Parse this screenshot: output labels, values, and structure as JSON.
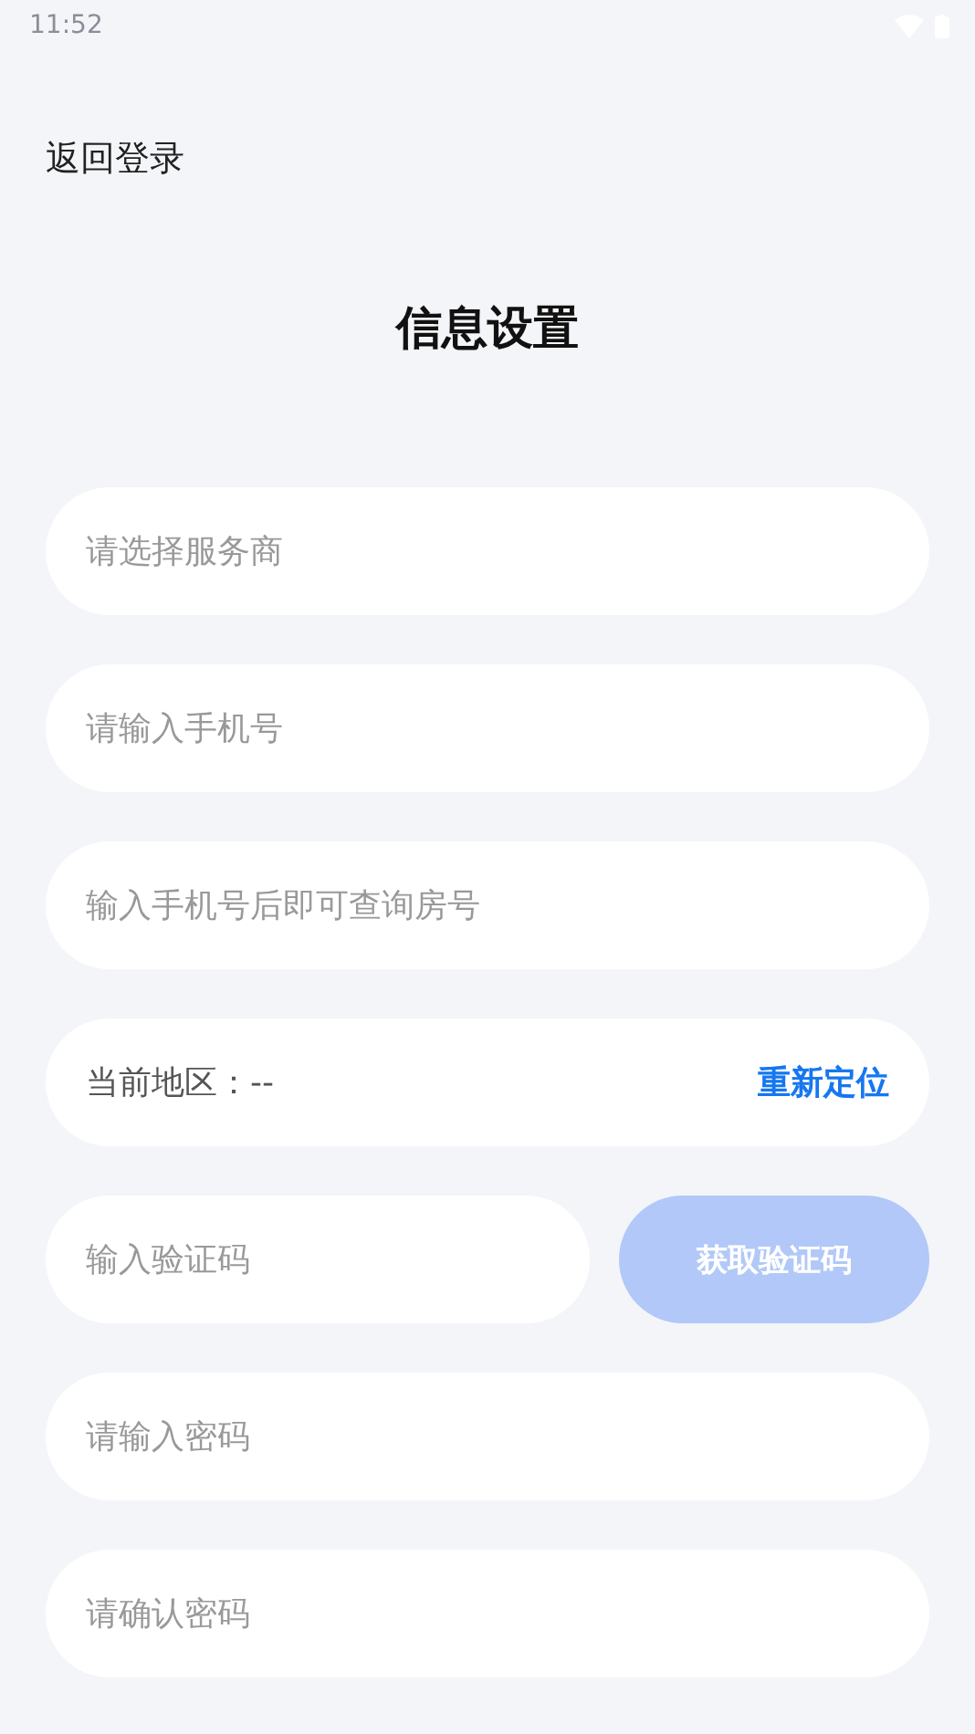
{
  "status_bar": {
    "time": "11:52"
  },
  "back_link": "返回登录",
  "title": "信息设置",
  "fields": [
    {
      "kind": "select",
      "placeholder": "请选择服务商"
    },
    {
      "kind": "input",
      "placeholder": "请输入手机号"
    },
    {
      "kind": "input",
      "placeholder": "输入手机号后即可查询房号"
    },
    {
      "kind": "location",
      "label": "当前地区：--",
      "action": "重新定位"
    },
    {
      "kind": "code",
      "placeholder": "输入验证码",
      "button": {
        "label": "获取验证码",
        "disabled": true
      }
    },
    {
      "kind": "password",
      "placeholder": "请输入密码"
    },
    {
      "kind": "password",
      "placeholder": "请确认密码"
    }
  ]
}
